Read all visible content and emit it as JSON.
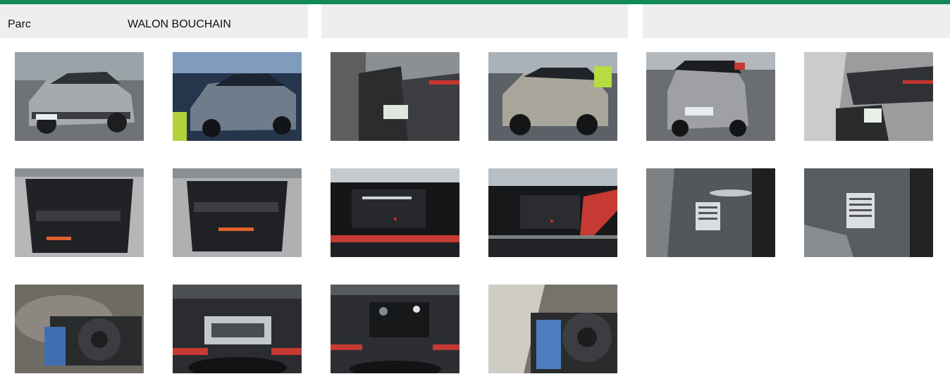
{
  "header": {
    "label": "Parc",
    "value": "WALON BOUCHAIN"
  },
  "colors": {
    "accent": "#0f8a55",
    "panel": "#eeeeee"
  },
  "gallery": {
    "photos": [
      {
        "subject": "car-front-left-exterior"
      },
      {
        "subject": "car-front-exterior-blue-tint"
      },
      {
        "subject": "front-seats-interior"
      },
      {
        "subject": "car-rear-right-exterior"
      },
      {
        "subject": "car-rear-exterior"
      },
      {
        "subject": "interior-passenger-side"
      },
      {
        "subject": "trunk-open"
      },
      {
        "subject": "trunk-open-2"
      },
      {
        "subject": "infotainment-screen"
      },
      {
        "subject": "infotainment-screen-2"
      },
      {
        "subject": "door-pillar-label"
      },
      {
        "subject": "door-pillar-label-2"
      },
      {
        "subject": "spare-wheel-well"
      },
      {
        "subject": "instrument-cluster"
      },
      {
        "subject": "instrument-cluster-2"
      },
      {
        "subject": "spare-wheel-well-2"
      }
    ]
  }
}
